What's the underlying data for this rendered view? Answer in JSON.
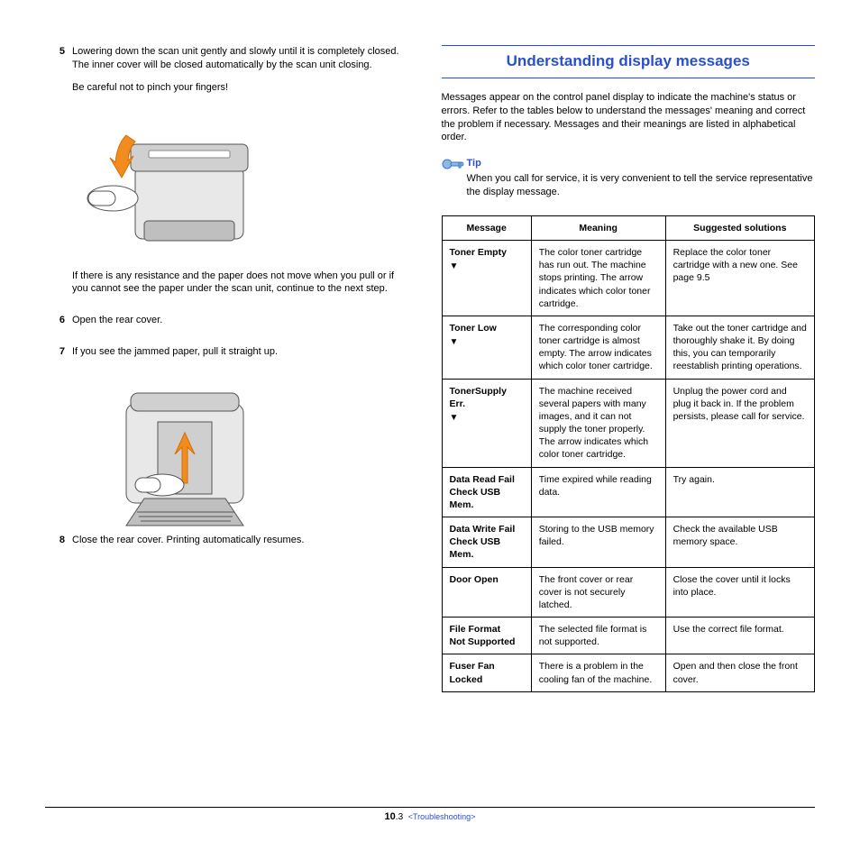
{
  "left": {
    "steps": [
      {
        "num": "5",
        "paras": [
          "Lowering down the scan unit gently and slowly until it is completely closed. The inner cover will be closed automatically by the scan unit closing.",
          "Be careful not to pinch your fingers!"
        ],
        "figure": true,
        "after": [
          "If there is any resistance and the paper does not move when you pull or if you cannot see the paper under the scan unit, continue to the next step."
        ]
      },
      {
        "num": "6",
        "paras": [
          "Open the rear cover."
        ]
      },
      {
        "num": "7",
        "paras": [
          "If you see the jammed paper, pull it straight up."
        ],
        "figure": true
      },
      {
        "num": "8",
        "paras": [
          "Close the rear cover. Printing automatically resumes."
        ]
      }
    ]
  },
  "right": {
    "title": "Understanding display messages",
    "intro": "Messages appear on the control panel display to indicate the machine's status or errors. Refer to the tables below to understand the messages' meaning and correct the problem if necessary. Messages and their meanings are listed in alphabetical order.",
    "tip_label": "Tip",
    "tip_text": "When you call for service, it is very convenient to tell the service representative the display message.",
    "headers": [
      "Message",
      "Meaning",
      "Suggested solutions"
    ],
    "rows": [
      {
        "msg": "Toner Empty",
        "arrow": true,
        "meaning": "The color toner cartridge has run out. The machine stops printing. The arrow indicates which color toner cartridge.",
        "solution": "Replace the color toner cartridge with a new one. See page 9.5"
      },
      {
        "msg": "Toner Low",
        "arrow": true,
        "meaning": "The corresponding color toner cartridge is almost empty. The arrow indicates which color toner cartridge.",
        "solution": "Take out the toner cartridge and thoroughly shake it. By doing this, you can temporarily reestablish printing operations."
      },
      {
        "msg": "TonerSupply Err.",
        "arrow": true,
        "meaning": "The machine received several papers with many images, and it can not supply the toner properly. The arrow indicates which color toner cartridge.",
        "solution": "Unplug the power cord and plug it back in. If the problem persists, please call for service."
      },
      {
        "msg": "Data Read Fail\nCheck USB Mem.",
        "arrow": false,
        "meaning": "Time expired while reading data.",
        "solution": "Try again."
      },
      {
        "msg": "Data Write Fail\nCheck USB Mem.",
        "arrow": false,
        "meaning": "Storing to the USB memory failed.",
        "solution": "Check the available USB memory space."
      },
      {
        "msg": "Door Open",
        "arrow": false,
        "meaning": "The front cover or rear cover is not securely latched.",
        "solution": "Close the cover until it locks into place."
      },
      {
        "msg": "File Format\nNot Supported",
        "arrow": false,
        "meaning": "The selected file format is not supported.",
        "solution": "Use the correct file format."
      },
      {
        "msg": "Fuser Fan\nLocked",
        "arrow": false,
        "meaning": "There is a problem in the cooling fan of the machine.",
        "solution": "Open and then close the front cover."
      }
    ]
  },
  "footer": {
    "page_bold": "10",
    "page_rest": ".3",
    "section": "<Troubleshooting>"
  }
}
